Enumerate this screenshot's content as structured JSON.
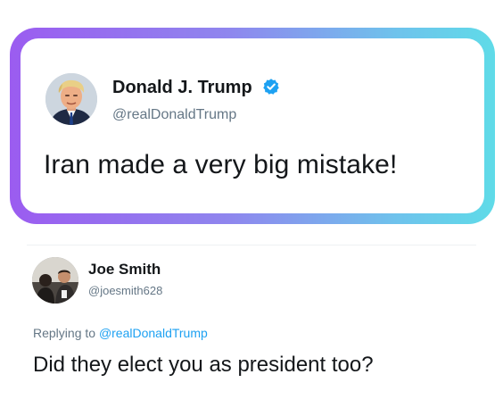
{
  "tweet": {
    "author_name": "Donald J. Trump",
    "author_handle": "@realDonaldTrump",
    "verified": true,
    "text": "Iran made a very big mistake!",
    "avatar_icon": "profile-photo",
    "frame_gradient": [
      "#9b5cf0",
      "#5fdbe8"
    ]
  },
  "reply": {
    "author_name": "Joe Smith",
    "author_handle": "@joesmith628",
    "replying_prefix": "Replying to ",
    "replying_to_handle": "@realDonaldTrump",
    "text": "Did they elect you as president too?",
    "avatar_icon": "profile-photo"
  },
  "colors": {
    "text_primary": "#14171a",
    "text_secondary": "#657786",
    "link": "#1da1f2",
    "verified_badge": "#1da1f2"
  }
}
